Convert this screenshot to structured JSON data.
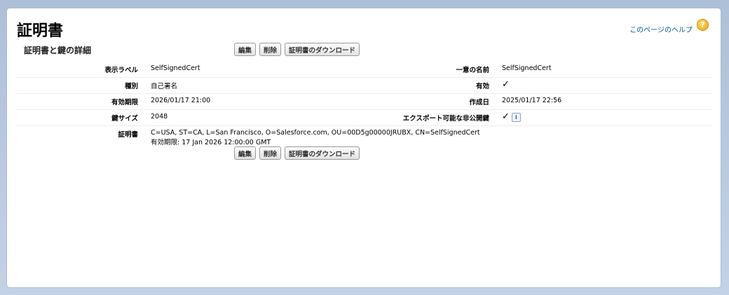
{
  "page": {
    "title": "証明書",
    "help_link": "このページのヘルプ",
    "help_icon": "help-icon"
  },
  "section": {
    "title": "証明書と鍵の詳細"
  },
  "buttons": {
    "edit": "編集",
    "delete": "削除",
    "download": "証明書のダウンロード"
  },
  "details": {
    "label_label": "表示ラベル",
    "label_value": "SelfSignedCert",
    "unique_name_label": "一意の名前",
    "unique_name_value": "SelfSignedCert",
    "type_label": "種別",
    "type_value": "自己署名",
    "active_label": "有効",
    "active_value": "✓",
    "expiration_label": "有効期限",
    "expiration_value": "2026/01/17 21:00",
    "created_label": "作成日",
    "created_value": "2025/01/17 22:56",
    "key_size_label": "鍵サイズ",
    "key_size_value": "2048",
    "exportable_label": "エクスポート可能な非公開鍵",
    "exportable_value": "✓",
    "certificate_label": "証明書",
    "certificate_line1": "C=USA, ST=CA, L=San Francisco, O=Salesforce.com, OU=00D5g00000JRUBX, CN=SelfSignedCert",
    "certificate_line2": "有効期限: 17 Jan 2026 12:00:00 GMT"
  },
  "colors": {
    "background": "#b7c9e0",
    "link": "#015ba7",
    "help_icon": "#f0a400"
  }
}
